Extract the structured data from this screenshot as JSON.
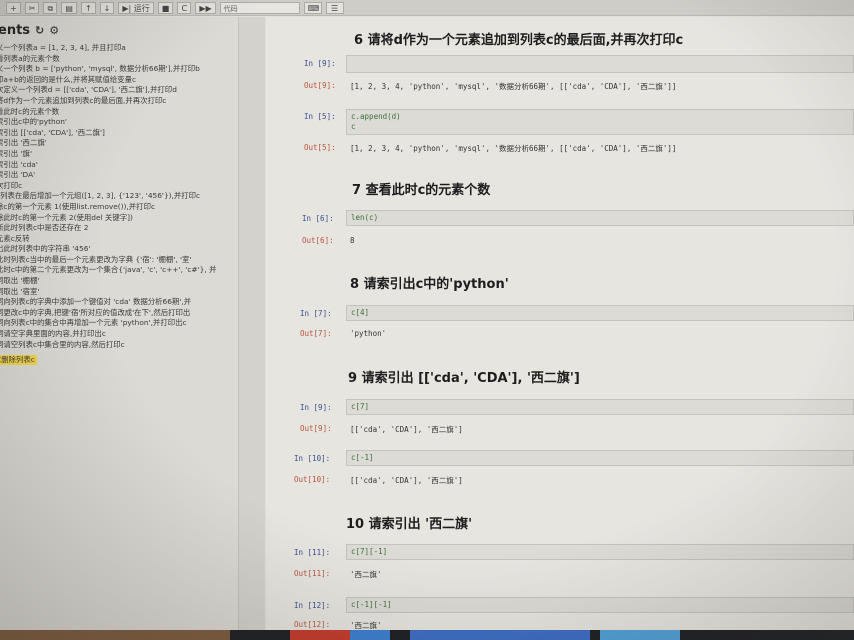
{
  "toolbar": {
    "buttons": [
      "+",
      "✂",
      "⧉",
      "▤",
      "↑",
      "↓",
      "▶| 运行",
      "■",
      "C",
      "▶▶"
    ],
    "cell_type": "代码",
    "icons": [
      "keyboard-icon",
      "list-icon"
    ]
  },
  "toc": {
    "title": "ents",
    "items": [
      "义一个列表a = [1,  2,  3,  4], 并且打印a",
      "看列表a的元素个数",
      "义一个列表 b = ['python', 'mysql', 数据分析66期'],并打印b",
      "印a+b的返回的是什么,并将其赋值给变量c",
      "次定义一个列表d = [['cda', 'CDA'], '西二旗'],并打印d",
      "将d作为一个元素追加到列表c的最后面,并再次打印c",
      "看此时c的元素个数",
      "索引出c中的'python'",
      "索引出 [['cda', 'CDA'], '西二旗']",
      "索引出 '西二旗'",
      "索引出 '旗'",
      "索引出 'cda'",
      "索引出 'DA'",
      "次打印c",
      "c列表在最后增加一个元组([1, 2, 3], {'123', '456'}),并打印c",
      "除c的第一个元素 1(使用list.remove()),并打印c",
      "除此时c的第一个元素 2(使用del 关键字])",
      "断此时列表c中是否还存在 2",
      "元素c反转",
      "出此时列表中的字符串 '456'",
      "此时列表c当中的最后一个元素更改为字典 {'宿': '棚棚', '室'",
      "此时c中的第二个元素更改为一个集合{'java', 'c', 'c++', 'c#'}, 并",
      "词取出 '棚棚'",
      "词取出 '宿室'",
      "词向列表c的字典中添加一个键值对 'cda' 数据分析66期',并",
      "词更改c中的字典,把键'宿'所对应的值改成'在下',然后打印出",
      "词向列表c中的集合中再增加一个元素 'python',并打印出c",
      "词请空字典里面的内容,并打印出c",
      "词请空列表c中集合里的内容,然后打印c",
      "C删除列表c"
    ]
  },
  "cells": {
    "h6": "6  请将d作为一个元素追加到列表c的最后面,并再次打印c",
    "in9_prompt": "In  [9]:",
    "in9_code": "",
    "out9_prompt": "Out[9]:",
    "out9_text": "[1, 2, 3, 4, 'python', 'mysql', '数据分析66期', [['cda', 'CDA'], '西二旗']]",
    "in5_prompt": "In  [5]:",
    "in5_code": "c.append(d)\nc",
    "out5_prompt": "Out[5]:",
    "out5_text": "[1, 2, 3, 4, 'python', 'mysql', '数据分析66期', [['cda', 'CDA'], '西二旗']]",
    "h7": "7  查看此时c的元素个数",
    "in6_prompt": "In  [6]:",
    "in6_code": "len(c)",
    "out6_prompt": "Out[6]:",
    "out6_text": "8",
    "h8": "8  请索引出c中的'python'",
    "in7_prompt": "In  [7]:",
    "in7_code": "c[4]",
    "out7_prompt": "Out[7]:",
    "out7_text": "'python'",
    "h9": "9  请索引出 [['cda', 'CDA'], '西二旗']",
    "in9b_prompt": "In  [9]:",
    "in9b_code": "c[7]",
    "out9b_prompt": "Out[9]:",
    "out9b_text": "[['cda', 'CDA'], '西二旗']",
    "in10_prompt": "In  [10]:",
    "in10_code": "c[-1]",
    "out10_prompt": "Out[10]:",
    "out10_text": "[['cda', 'CDA'], '西二旗']",
    "h10": "10  请索引出 '西二旗'",
    "in11_prompt": "In  [11]:",
    "in11_code": "c[7][-1]",
    "out11_prompt": "Out[11]:",
    "out11_text": "'西二旗'",
    "in12_prompt": "In  [12]:",
    "in12_code": "c[-1][-1]",
    "out12_prompt": "Out[12]:",
    "out12_text": "'西二旗'"
  }
}
